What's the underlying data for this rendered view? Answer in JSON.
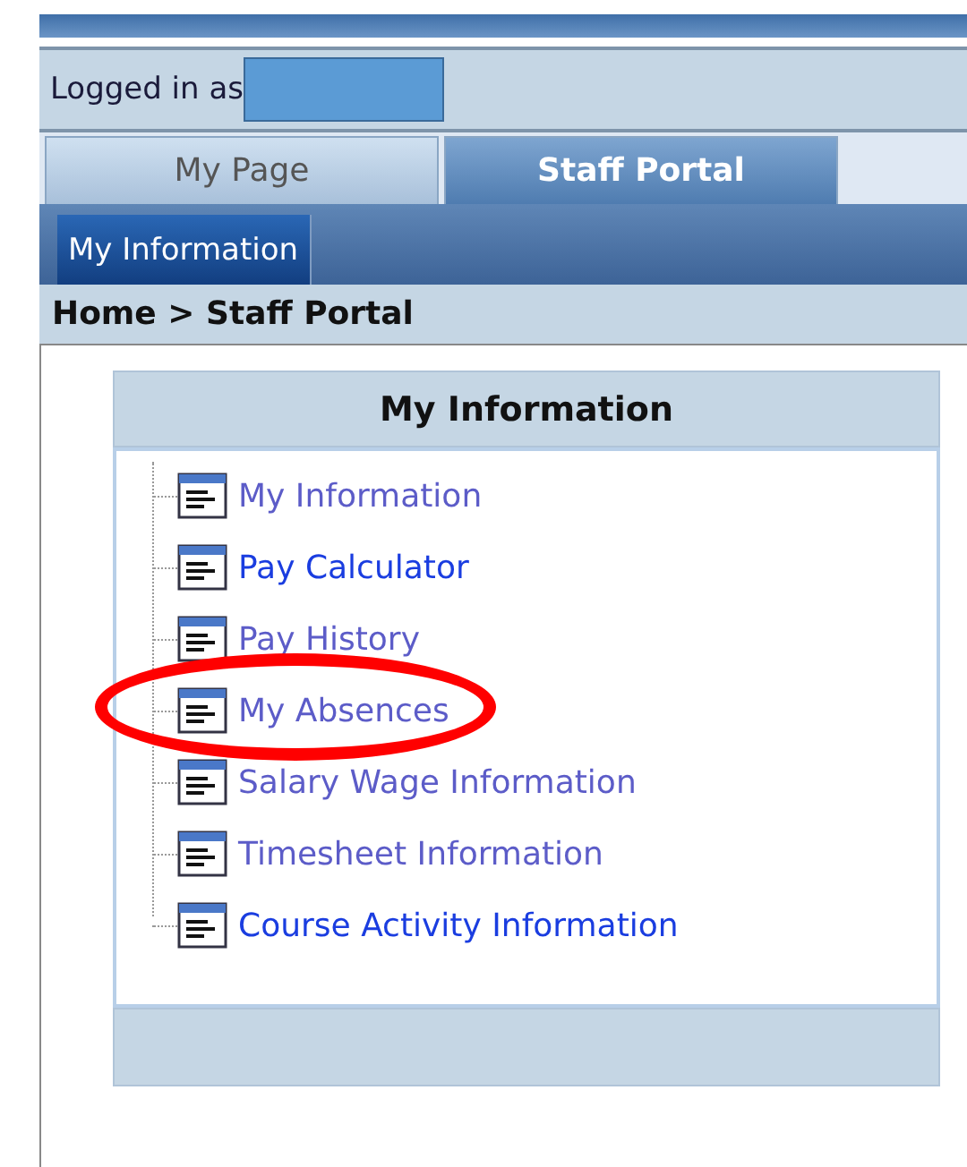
{
  "login_bar": {
    "label": "Logged in as"
  },
  "tabs": [
    {
      "label": "My Page",
      "selected": false
    },
    {
      "label": "Staff Portal",
      "selected": true
    }
  ],
  "subnav": [
    {
      "label": "My Information",
      "selected": true
    }
  ],
  "breadcrumb": "Home > Staff Portal",
  "panel": {
    "title": "My Information",
    "items": [
      {
        "label": "My Information",
        "visited": true,
        "circled": false
      },
      {
        "label": "Pay Calculator",
        "visited": false,
        "circled": false
      },
      {
        "label": "Pay History",
        "visited": true,
        "circled": false
      },
      {
        "label": "My Absences",
        "visited": true,
        "circled": true
      },
      {
        "label": "Salary Wage Information",
        "visited": true,
        "circled": false
      },
      {
        "label": "Timesheet Information",
        "visited": true,
        "circled": false
      },
      {
        "label": "Course Activity Information",
        "visited": false,
        "circled": false
      }
    ]
  }
}
